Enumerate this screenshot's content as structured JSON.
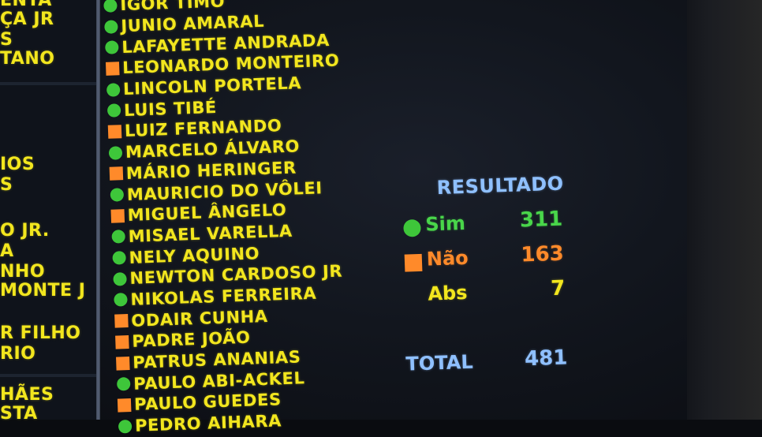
{
  "left_column": [
    "ENTA",
    "ÇA JR",
    "S",
    "TANO",
    "IOS",
    "S",
    "O JR.",
    "A",
    "NHO",
    "MONTE J",
    "R FILHO",
    "RIO",
    "HÃES",
    "STA"
  ],
  "members": [
    {
      "name": "IGOR TIMO",
      "vote": "sim"
    },
    {
      "name": "JUNIO AMARAL",
      "vote": "sim"
    },
    {
      "name": "LAFAYETTE ANDRADA",
      "vote": "sim"
    },
    {
      "name": "LEONARDO MONTEIRO",
      "vote": "nao"
    },
    {
      "name": "LINCOLN PORTELA",
      "vote": "sim"
    },
    {
      "name": "LUIS TIBÉ",
      "vote": "sim"
    },
    {
      "name": "LUIZ FERNANDO",
      "vote": "nao"
    },
    {
      "name": "MARCELO ÁLVARO",
      "vote": "sim"
    },
    {
      "name": "MÁRIO HERINGER",
      "vote": "nao"
    },
    {
      "name": "MAURICIO DO VÔLEI",
      "vote": "sim"
    },
    {
      "name": "MIGUEL ÂNGELO",
      "vote": "nao"
    },
    {
      "name": "MISAEL VARELLA",
      "vote": "sim"
    },
    {
      "name": "NELY AQUINO",
      "vote": "sim"
    },
    {
      "name": "NEWTON CARDOSO JR",
      "vote": "sim"
    },
    {
      "name": "NIKOLAS FERREIRA",
      "vote": "sim"
    },
    {
      "name": "ODAIR CUNHA",
      "vote": "nao"
    },
    {
      "name": "PADRE JOÃO",
      "vote": "nao"
    },
    {
      "name": "PATRUS ANANIAS",
      "vote": "nao"
    },
    {
      "name": "PAULO ABI-ACKEL",
      "vote": "sim"
    },
    {
      "name": "PAULO GUEDES",
      "vote": "nao"
    },
    {
      "name": "PEDRO AIHARA",
      "vote": "sim"
    }
  ],
  "result": {
    "title": "RESULTADO",
    "rows": [
      {
        "label": "Sim",
        "value": "311"
      },
      {
        "label": "Não",
        "value": "163"
      },
      {
        "label": "Abs",
        "value": "7"
      }
    ],
    "total_label": "TOTAL",
    "total_value": "481"
  },
  "colors": {
    "sim": "#3ec63a",
    "nao": "#ff8a2a",
    "abs": "#f2e61e",
    "title": "#8fc0ff",
    "names": "#f2e61e"
  },
  "icons": {
    "sim": "green-circle-icon",
    "nao": "orange-square-icon",
    "abs": "yellow-diamond-icon"
  }
}
